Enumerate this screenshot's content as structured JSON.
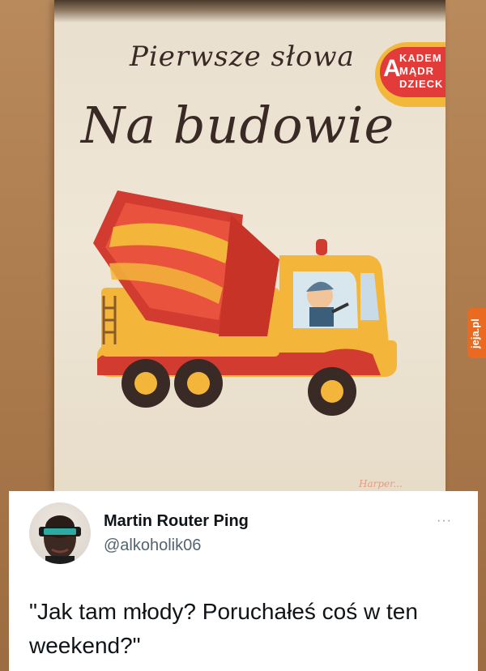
{
  "book": {
    "subtitle": "Pierwsze słowa",
    "title": "Na budowie",
    "publisher_badge": {
      "letter": "A",
      "lines": [
        "KADEM",
        "MĄDR",
        "DZIECK"
      ]
    },
    "publisher": "Harper..."
  },
  "watermark": "jeja.pl",
  "tweet": {
    "display_name": "Martin Router Ping",
    "handle": "@alkoholik06",
    "more_label": "···",
    "text": "\"Jak tam młody? Poruchałeś coś w ten weekend?\""
  },
  "colors": {
    "accent_orange": "#ea6a1f",
    "truck_red": "#d23b2f",
    "truck_yellow": "#f3b63b"
  }
}
